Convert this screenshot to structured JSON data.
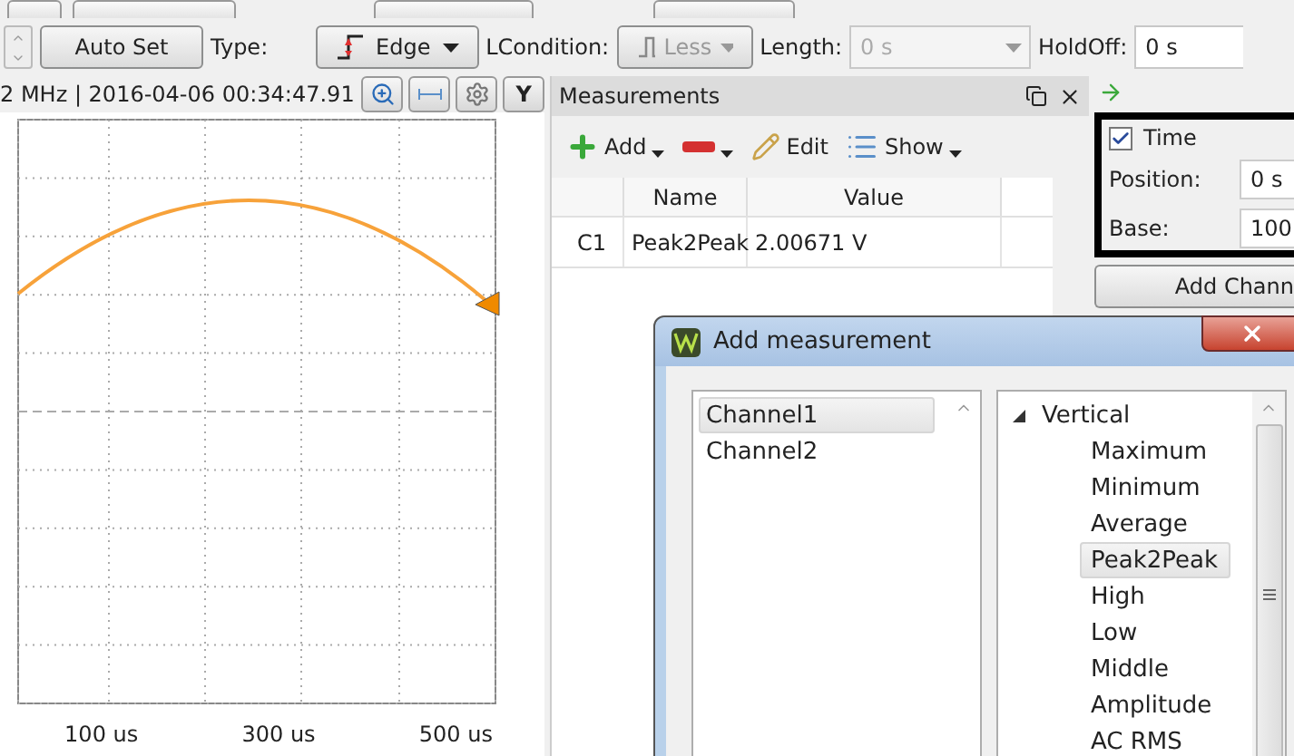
{
  "toolbar": {
    "auto_set": "Auto Set",
    "type_label": "Type:",
    "type_value": "Edge",
    "lcondition_label": "LCondition:",
    "lcondition": {
      "value": "Less",
      "disabled": true
    },
    "length_label": "Length:",
    "length": {
      "value": "0 s",
      "disabled": true
    },
    "holdoff_label": "HoldOff:",
    "holdoff": {
      "value": "0 s",
      "disabled": false
    }
  },
  "scope": {
    "info": "2 MHz | 2016-04-06 00:34:47.91",
    "y_button": "Y",
    "x_labels": [
      "100 us",
      "300 us",
      "500 us"
    ]
  },
  "measurements": {
    "title": "Measurements",
    "actions": [
      {
        "kind": "add",
        "label": "Add",
        "menu": true
      },
      {
        "kind": "remove",
        "menu": true
      },
      {
        "kind": "edit",
        "label": "Edit",
        "menu": false
      },
      {
        "kind": "show",
        "label": "Show",
        "menu": true
      }
    ],
    "columns": [
      "Name",
      "Value"
    ],
    "rows": [
      {
        "channel": "C1",
        "name": "Peak2Peak",
        "value": "2.00671 V"
      }
    ]
  },
  "timebase": {
    "time": {
      "label": "Time",
      "checked": true
    },
    "position_label": "Position:",
    "position": "0 s",
    "base_label": "Base:",
    "base": "100",
    "add_channel": "Add Chann"
  },
  "dialog": {
    "title": "Add measurement",
    "channels": [
      {
        "label": "Channel1",
        "selected": true
      },
      {
        "label": "Channel2",
        "selected": false
      }
    ],
    "tree": [
      {
        "label": "Vertical",
        "expanded": true,
        "children": [
          {
            "label": "Maximum",
            "selected": false
          },
          {
            "label": "Minimum",
            "selected": false
          },
          {
            "label": "Average",
            "selected": false
          },
          {
            "label": "Peak2Peak",
            "selected": true
          },
          {
            "label": "High",
            "selected": false
          },
          {
            "label": "Low",
            "selected": false
          },
          {
            "label": "Middle",
            "selected": false
          },
          {
            "label": "Amplitude",
            "selected": false
          },
          {
            "label": "AC RMS",
            "selected": false
          }
        ]
      }
    ]
  }
}
